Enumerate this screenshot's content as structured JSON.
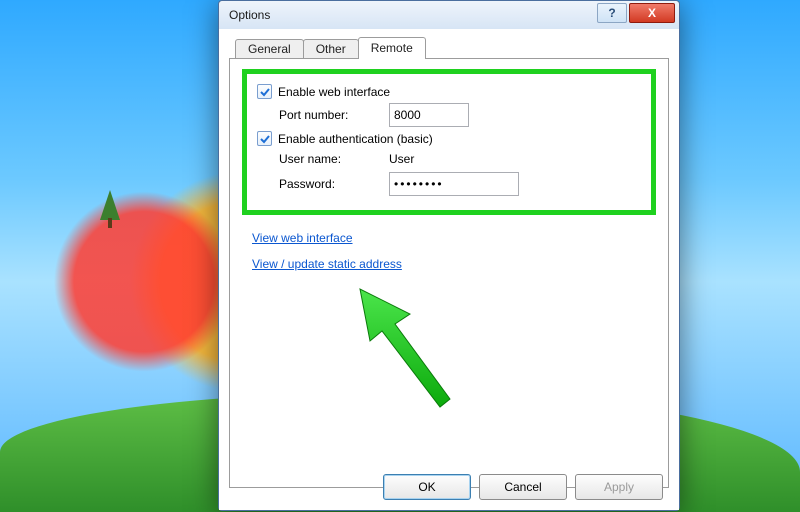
{
  "window": {
    "title": "Options",
    "help": "?",
    "close": "X"
  },
  "tabs": {
    "general": "General",
    "other": "Other",
    "remote": "Remote"
  },
  "remote": {
    "enable_web_label": "Enable web interface",
    "port_label": "Port number:",
    "port_value": "8000",
    "enable_auth_label": "Enable authentication (basic)",
    "user_label": "User name:",
    "user_value": "User",
    "password_label": "Password:",
    "password_value": "••••••••",
    "link_view": "View web interface",
    "link_static": "View / update static address"
  },
  "buttons": {
    "ok": "OK",
    "cancel": "Cancel",
    "apply": "Apply"
  }
}
